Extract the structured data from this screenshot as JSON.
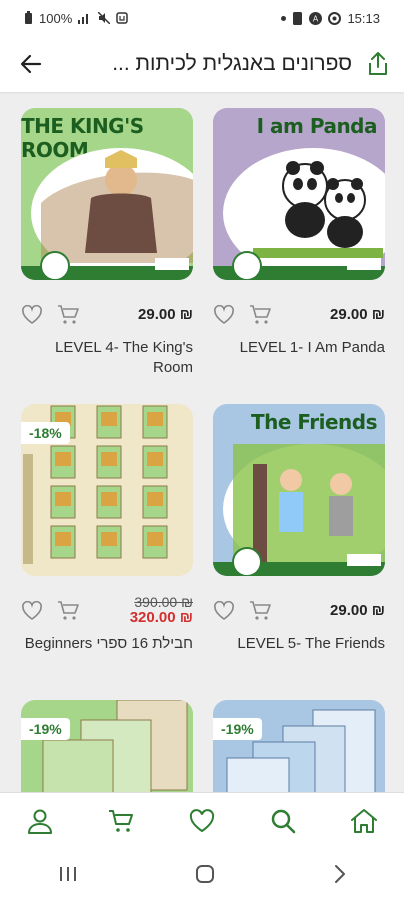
{
  "status": {
    "battery": "100%",
    "time": "15:13"
  },
  "header": {
    "title": "ספרונים באנגלית לכיתות ..."
  },
  "products": [
    {
      "name": "LEVEL 4- The King's Room",
      "price": "29.00 ₪",
      "cover_text": "THE KING'S ROOM",
      "color": "#a5d68a"
    },
    {
      "name": "LEVEL 1- I Am Panda",
      "price": "29.00 ₪",
      "cover_text": "I am Panda",
      "color": "#b7a6cc"
    },
    {
      "name": "חבילת 16 ספרי Beginners",
      "price": "320.00 ₪",
      "old_price": "390.00 ₪",
      "discount": "-18%",
      "color": "#f0e6c8"
    },
    {
      "name": "LEVEL 5- The Friends",
      "price": "29.00 ₪",
      "cover_text": "The Friends",
      "color": "#a9c6e3"
    },
    {
      "discount": "-19%",
      "color": "#a5d68a"
    },
    {
      "discount": "-19%",
      "color": "#a9c6e3"
    }
  ],
  "colors": {
    "accent": "#2e7d32",
    "sale": "#d32f2f"
  }
}
